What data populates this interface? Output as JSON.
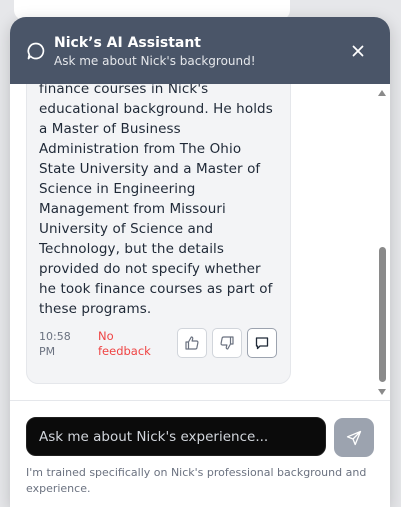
{
  "header": {
    "title": "Nick’s AI Assistant",
    "subtitle": "Ask me about Nick's background!",
    "icons": {
      "chat": "chat-bubble-icon",
      "close": "close-icon"
    }
  },
  "message": {
    "lines": [
      "finance courses in Nick's",
      "educational background. He holds",
      "a Master of Business",
      "Administration from The Ohio",
      "State University and a Master of",
      "Science in Engineering",
      "Management from Missouri",
      "University of Science and",
      "Technology, but the details",
      "provided do not specify whether",
      "he took finance courses as part of",
      "these programs."
    ],
    "time_line1": "10:58",
    "time_line2": "PM",
    "feedback_line1": "No",
    "feedback_line2": "feedback",
    "buttons": [
      "thumbs-up-icon",
      "thumbs-down-icon",
      "comment-icon"
    ]
  },
  "input": {
    "placeholder": "Ask me about Nick's experience...",
    "value": ""
  },
  "send": {
    "icon": "send-icon"
  },
  "footer": {
    "note": "I'm trained specifically on Nick's professional background and experience."
  },
  "colors": {
    "header_bg": "#4a5568",
    "bubble_bg": "#f3f4f6",
    "input_bg": "#0b0b0b",
    "send_bg": "#9ca3af",
    "feedback_text": "#ef4444"
  }
}
